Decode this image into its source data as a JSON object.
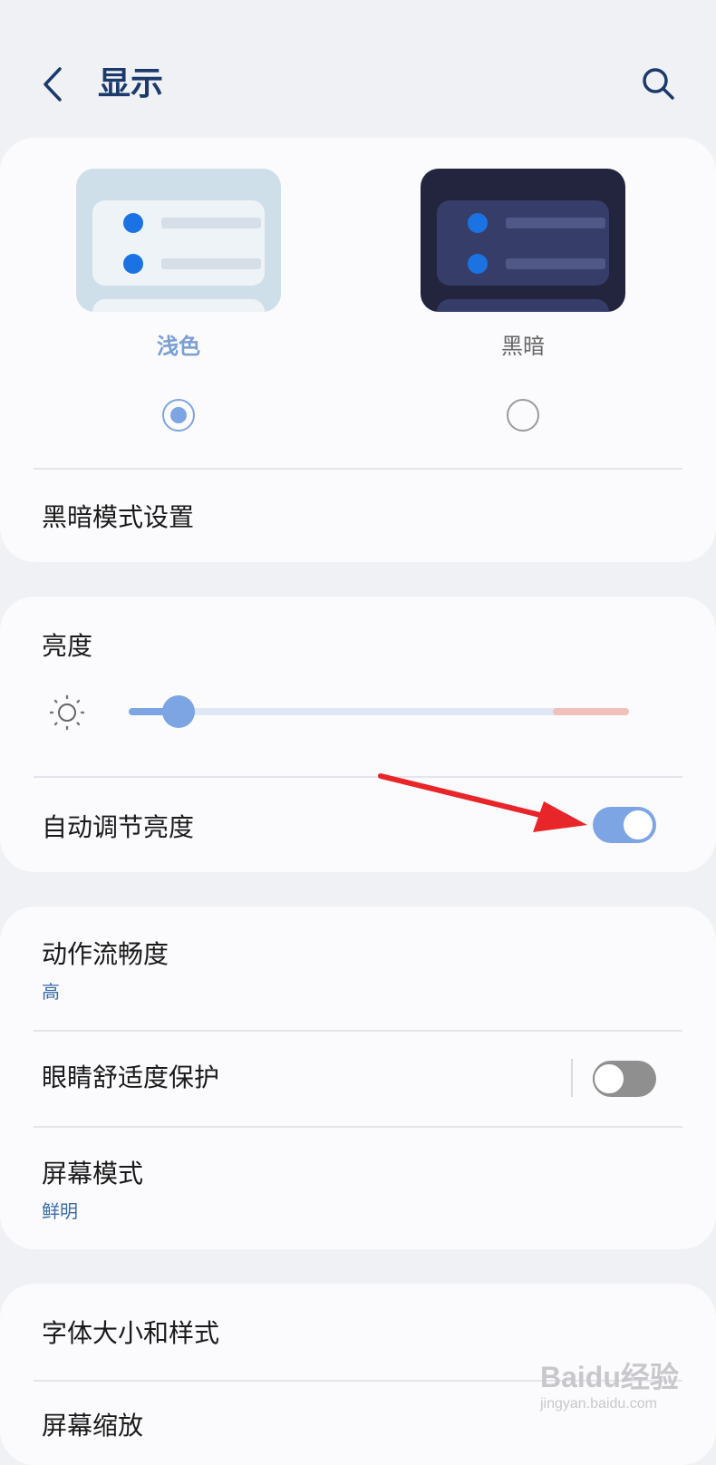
{
  "header": {
    "title": "显示",
    "back_icon": "chevron-left-icon",
    "search_icon": "search-icon"
  },
  "theme": {
    "options": [
      {
        "label": "浅色",
        "selected": true
      },
      {
        "label": "黑暗",
        "selected": false
      }
    ],
    "dark_mode_settings_label": "黑暗模式设置"
  },
  "brightness": {
    "label": "亮度",
    "level_percent": 10,
    "auto_label": "自动调节亮度",
    "auto_on": true
  },
  "motion": {
    "label": "动作流畅度",
    "value": "高"
  },
  "eye_comfort": {
    "label": "眼睛舒适度保护",
    "on": false
  },
  "screen_mode": {
    "label": "屏幕模式",
    "value": "鲜明"
  },
  "font": {
    "label": "字体大小和样式",
    "next_label_partial": "屏幕缩放"
  },
  "watermark": {
    "text": "Baidu经验",
    "url": "jingyan.baidu.com"
  },
  "colors": {
    "accent": "#7ea5e3",
    "title": "#1b3a6b",
    "annotation_arrow": "#e8262a"
  }
}
